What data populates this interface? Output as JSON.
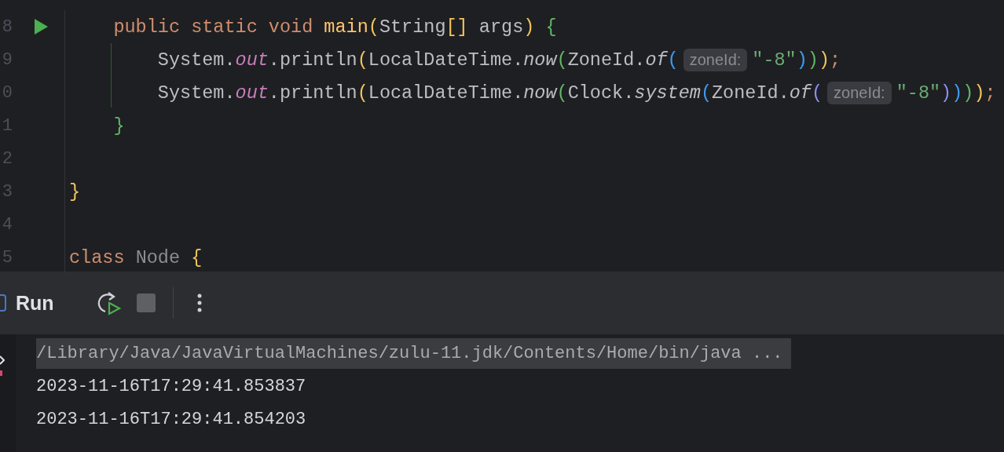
{
  "editor": {
    "lines": [
      {
        "number": "8",
        "run_marker": true,
        "segments": [
          {
            "kind": "code",
            "tokens": [
              {
                "kind": "kw",
                "text": "    public static void "
              },
              {
                "kind": "fn",
                "text": "main"
              },
              {
                "kind": "b1",
                "text": "("
              },
              {
                "kind": "plain",
                "text": "String"
              },
              {
                "kind": "b1",
                "text": "[]"
              },
              {
                "kind": "plain",
                "text": " args"
              },
              {
                "kind": "b1",
                "text": ")"
              },
              {
                "kind": "b2",
                "text": " {"
              }
            ]
          }
        ]
      },
      {
        "number": "9",
        "run_marker": false,
        "segments": [
          {
            "kind": "code",
            "tokens": [
              {
                "kind": "plain",
                "text": "        System."
              },
              {
                "kind": "field",
                "text": "out"
              },
              {
                "kind": "plain",
                "text": ".println"
              },
              {
                "kind": "b1",
                "text": "("
              },
              {
                "kind": "plain",
                "text": "LocalDateTime."
              },
              {
                "kind": "static",
                "text": "now"
              },
              {
                "kind": "b2",
                "text": "("
              },
              {
                "kind": "plain",
                "text": "ZoneId."
              },
              {
                "kind": "static",
                "text": "of"
              },
              {
                "kind": "b3",
                "text": "("
              }
            ]
          },
          {
            "kind": "hint",
            "text": "zoneId:"
          },
          {
            "kind": "code",
            "tokens": [
              {
                "kind": "str",
                "text": "\"-8\""
              },
              {
                "kind": "b3",
                "text": ")"
              },
              {
                "kind": "b2",
                "text": ")"
              },
              {
                "kind": "b1",
                "text": ")"
              },
              {
                "kind": "semi",
                "text": ";"
              }
            ]
          }
        ]
      },
      {
        "number": "0",
        "run_marker": false,
        "segments": [
          {
            "kind": "code",
            "tokens": [
              {
                "kind": "plain",
                "text": "        System."
              },
              {
                "kind": "field",
                "text": "out"
              },
              {
                "kind": "plain",
                "text": ".println"
              },
              {
                "kind": "b1",
                "text": "("
              },
              {
                "kind": "plain",
                "text": "LocalDateTime."
              },
              {
                "kind": "static",
                "text": "now"
              },
              {
                "kind": "b2",
                "text": "("
              },
              {
                "kind": "plain",
                "text": "Clock."
              },
              {
                "kind": "static",
                "text": "system"
              },
              {
                "kind": "b3",
                "text": "("
              },
              {
                "kind": "plain",
                "text": "ZoneId."
              },
              {
                "kind": "static",
                "text": "of"
              },
              {
                "kind": "b4",
                "text": "("
              }
            ]
          },
          {
            "kind": "hint",
            "text": "zoneId:"
          },
          {
            "kind": "code",
            "tokens": [
              {
                "kind": "str",
                "text": "\"-8\""
              },
              {
                "kind": "b4",
                "text": ")"
              },
              {
                "kind": "b3",
                "text": ")"
              },
              {
                "kind": "b2",
                "text": ")"
              },
              {
                "kind": "b1",
                "text": ")"
              },
              {
                "kind": "semi",
                "text": ";"
              }
            ]
          }
        ]
      },
      {
        "number": "1",
        "run_marker": false,
        "segments": [
          {
            "kind": "code",
            "tokens": [
              {
                "kind": "b2",
                "text": "    }"
              }
            ]
          }
        ]
      },
      {
        "number": "2",
        "run_marker": false
      },
      {
        "number": "3",
        "run_marker": false,
        "segments": [
          {
            "kind": "code",
            "tokens": [
              {
                "kind": "b1",
                "text": "}"
              }
            ]
          }
        ]
      },
      {
        "number": "4",
        "run_marker": false
      },
      {
        "number": "5",
        "run_marker": false,
        "segments": [
          {
            "kind": "code",
            "tokens": [
              {
                "kind": "kw",
                "text": "class "
              },
              {
                "kind": "dim",
                "text": "Node"
              },
              {
                "kind": "b1",
                "text": " {"
              }
            ]
          }
        ]
      }
    ]
  },
  "run_panel": {
    "title": "Run"
  },
  "console": {
    "lines": [
      {
        "text": "/Library/Java/JavaVirtualMachines/zulu-11.jdk/Contents/Home/bin/java ...",
        "selected": true
      },
      {
        "text": "2023-11-16T17:29:41.853837",
        "selected": false
      },
      {
        "text": "2023-11-16T17:29:41.854203",
        "selected": false
      }
    ]
  }
}
